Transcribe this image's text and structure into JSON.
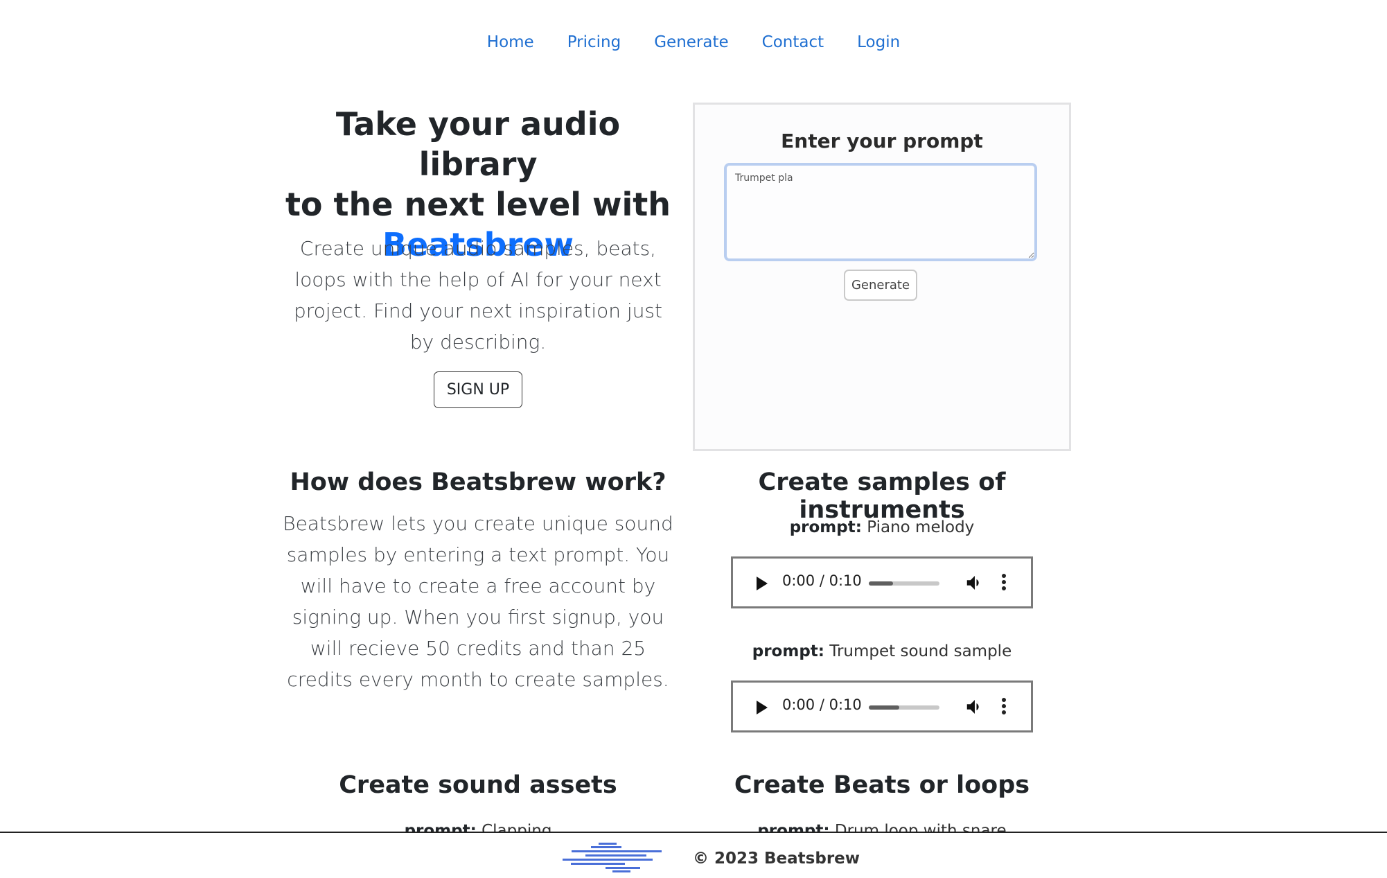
{
  "nav": {
    "items": [
      {
        "label": "Home"
      },
      {
        "label": "Pricing"
      },
      {
        "label": "Generate"
      },
      {
        "label": "Contact"
      },
      {
        "label": "Login"
      }
    ]
  },
  "hero": {
    "title_line1": "Take your audio library",
    "title_line2": "to the next level with",
    "brand": "Beatsbrew",
    "lead": "Create unique audio samples, beats, loops with the help of AI for your next project. Find your next inspiration just by describing.",
    "signup_label": "SIGN UP"
  },
  "prompt_card": {
    "title": "Enter your prompt",
    "textarea_value": "Trumpet pla",
    "generate_label": "Generate"
  },
  "how": {
    "title": "How does Beatsbrew work?",
    "body": "Beatsbrew lets you create unique sound samples by entering a text prompt. You will have to create a free account by signing up. When you first signup, you will recieve 50 credits and than 25 credits every month to create samples."
  },
  "instruments": {
    "title": "Create samples of instruments",
    "samples": [
      {
        "prompt_key": "prompt:",
        "prompt_text": " Piano melody",
        "time": "0:00 / 0:10",
        "buffered_fraction": 0.34
      },
      {
        "prompt_key": "prompt:",
        "prompt_text": " Trumpet sound sample",
        "time": "0:00 / 0:10",
        "buffered_fraction": 0.43
      }
    ]
  },
  "assets": {
    "title": "Create sound assets",
    "prompt_key": "prompt:",
    "prompt_text": " Clapping"
  },
  "beats": {
    "title": "Create Beats or loops",
    "prompt_key": "prompt:",
    "prompt_text": " Drum loop with snare"
  },
  "footer": {
    "copyright": "© 2023 Beatsbrew",
    "logo_color": "#4a6fd8"
  },
  "colors": {
    "brand": "#0d6efd",
    "nav_link": "#1f6fd1"
  }
}
